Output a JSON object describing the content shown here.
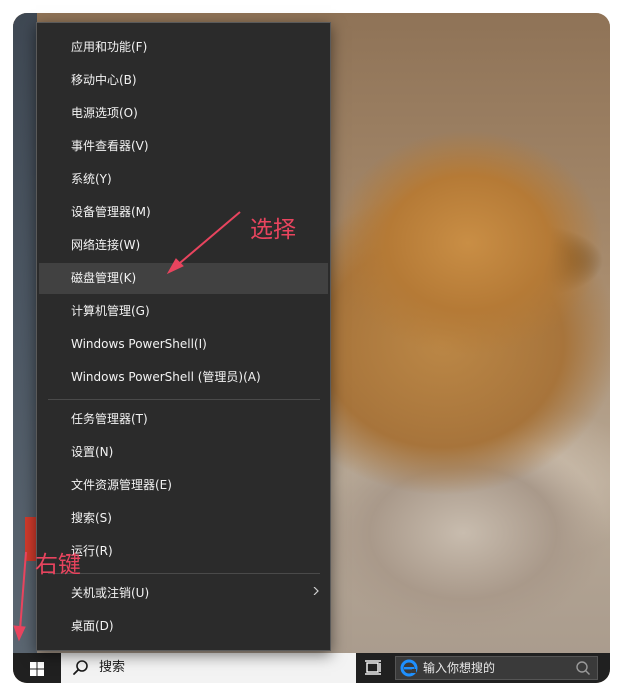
{
  "context_menu": {
    "items": [
      "应用和功能(F)",
      "移动中心(B)",
      "电源选项(O)",
      "事件查看器(V)",
      "系统(Y)",
      "设备管理器(M)",
      "网络连接(W)",
      "磁盘管理(K)",
      "计算机管理(G)",
      "Windows PowerShell(I)",
      "Windows PowerShell (管理员)(A)",
      "任务管理器(T)",
      "设置(N)",
      "文件资源管理器(E)",
      "搜索(S)",
      "运行(R)",
      "关机或注销(U)",
      "桌面(D)"
    ],
    "highlighted": "磁盘管理(K)"
  },
  "taskbar": {
    "search_label": "搜索",
    "ie_search_placeholder": "输入你想搜的"
  },
  "annotations": {
    "select_label": "选择",
    "right_click_label": "右键",
    "color": "#e8445e"
  },
  "icons": {
    "start": "windows-logo-icon",
    "search": "magnifier-icon",
    "task_view": "task-view-icon",
    "browser": "ie-browser-icon",
    "submenu": "chevron-right-icon"
  },
  "colors": {
    "menu_bg": "#2b2b2b",
    "menu_highlight": "#414141",
    "taskbar_bg": "#202020",
    "annotation": "#e8445e"
  }
}
